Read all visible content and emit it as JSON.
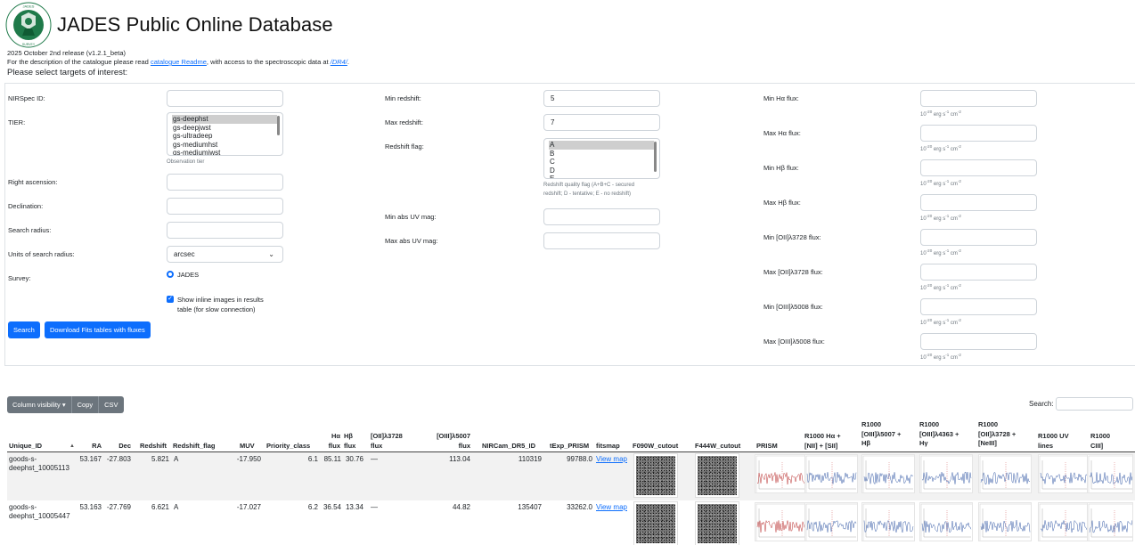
{
  "site": {
    "title": "JADES Public Online Database",
    "release": "2025 October 2nd release (v1.2.1_beta)",
    "desc_prefix": "For the description of the catalogue please read ",
    "readme_link": "catalogue Readme",
    "desc_middle": ", with access to the spectroscopic data at ",
    "dr4_link": "/DR4/",
    "desc_suffix": ".",
    "prompt": "Please select targets of interest:",
    "logo_text": "JADES · JWST ADVANCED DEEP EXTRAGALACTIC SURVEY"
  },
  "form": {
    "nirspec_id": {
      "label": "NIRSpec ID:",
      "value": ""
    },
    "tier": {
      "label": "TIER:",
      "options": [
        "gs-deephst",
        "gs-deepjwst",
        "gs-ultradeep",
        "gs-mediumhst",
        "gs-mediumjwst"
      ],
      "selected": "gs-deephst",
      "help": "Observation tier"
    },
    "ra": {
      "label": "Right ascension:",
      "value": ""
    },
    "dec": {
      "label": "Declination:",
      "value": ""
    },
    "search_radius": {
      "label": "Search radius:",
      "value": ""
    },
    "units": {
      "label": "Units of search radius:",
      "value": "arcsec"
    },
    "survey": {
      "label": "Survey:",
      "option": "JADES"
    },
    "inline_images": {
      "label_line1": "Show inline images in results",
      "label_line2": "table (for slow connection)",
      "checked": true
    },
    "search_btn": "Search",
    "download_btn": "Download Fits tables with fluxes",
    "min_z": {
      "label": "Min redshift:",
      "value": "5"
    },
    "max_z": {
      "label": "Max redshift:",
      "value": "7"
    },
    "z_flag": {
      "label": "Redshift flag:",
      "options": [
        "A",
        "B",
        "C",
        "D",
        "E"
      ],
      "selected": "A",
      "help_line1": "Redshift quality flag (A+B+C - secured",
      "help_line2": "redshift; D - tentative; E - no redshift)"
    },
    "min_muv": {
      "label": "Min abs UV mag:",
      "value": ""
    },
    "max_muv": {
      "label": "Max abs UV mag:",
      "value": ""
    },
    "flux_unit": "10",
    "flux_unit_exp": "-20",
    "flux_unit_rest": " erg s",
    "flux_unit_exp2": "-1",
    "flux_unit_rest2": " cm",
    "flux_unit_exp3": "-2",
    "flux_filters": [
      "Min Hα flux:",
      "Max Hα flux:",
      "Min Hβ flux:",
      "Max Hβ flux:",
      "Min [OII]λ3728 flux:",
      "Max [OII]λ3728 flux:",
      "Min [OIII]λ5008 flux:",
      "Max [OIII]λ5008 flux:"
    ]
  },
  "table_controls": {
    "col_vis": "Column visibility",
    "copy": "Copy",
    "csv": "CSV",
    "search_label": "Search:"
  },
  "table": {
    "headers": {
      "unique_id": "Unique_ID",
      "ra": "RA",
      "dec": "Dec",
      "redshift": "Redshift",
      "z_flag": "Redshift_flag",
      "muv": "MUV",
      "priority": "Priority_class",
      "ha_1": "Hα",
      "ha_2": "flux",
      "hb_1": "Hβ",
      "hb_2": "flux",
      "oii_1": "[OII]λ3728",
      "oii_2": "flux",
      "oiii_1": "[OIII]λ5007",
      "oiii_2": "flux",
      "nircam": "NIRCam_DR5_ID",
      "texp": "tExp_PRISM",
      "fitsmap": "fitsmap",
      "f090w": "F090W_cutout",
      "f444w": "F444W_cutout",
      "prism": "PRISM",
      "r1000ha_1": "R1000 Hα +",
      "r1000ha_2": "[NII] + [SII]",
      "r1000oiii_1": "R1000",
      "r1000oiii_2": "[OIII]λ5007 +",
      "r1000oiii_3": "Hβ",
      "r1000o4363_1": "R1000",
      "r1000o4363_2": "[OIII]λ4363 +",
      "r1000o4363_3": "Hγ",
      "r1000oii_1": "R1000",
      "r1000oii_2": "[OII]λ3728 +",
      "r1000oii_3": "[NeIII]",
      "r1000uv_1": "R1000 UV",
      "r1000uv_2": "lines",
      "r1000ciii_1": "R1000",
      "r1000ciii_2": "CIII]"
    },
    "rows": [
      {
        "id_1": "goods-s-",
        "id_2": "deephst_10005113",
        "ra": "53.167",
        "dec": "-27.803",
        "redshift": "5.821",
        "z_flag": "A",
        "muv": "-17.950",
        "priority": "6.1",
        "ha": "85.11",
        "hb": "30.76",
        "oii": "—",
        "oiii": "113.04",
        "nircam": "110319",
        "texp": "99788.0",
        "fitsmap": "View map"
      },
      {
        "id_1": "goods-s-",
        "id_2": "deephst_10005447",
        "ra": "53.163",
        "dec": "-27.769",
        "redshift": "6.621",
        "z_flag": "A",
        "muv": "-17.027",
        "priority": "6.2",
        "ha": "36.54",
        "hb": "13.34",
        "oii": "—",
        "oiii": "44.82",
        "nircam": "135407",
        "texp": "33262.0",
        "fitsmap": "View map"
      }
    ]
  },
  "colors": {
    "primary": "#0d6efd",
    "secondary": "#6c757d",
    "logo_green": "#1f7a4a"
  }
}
